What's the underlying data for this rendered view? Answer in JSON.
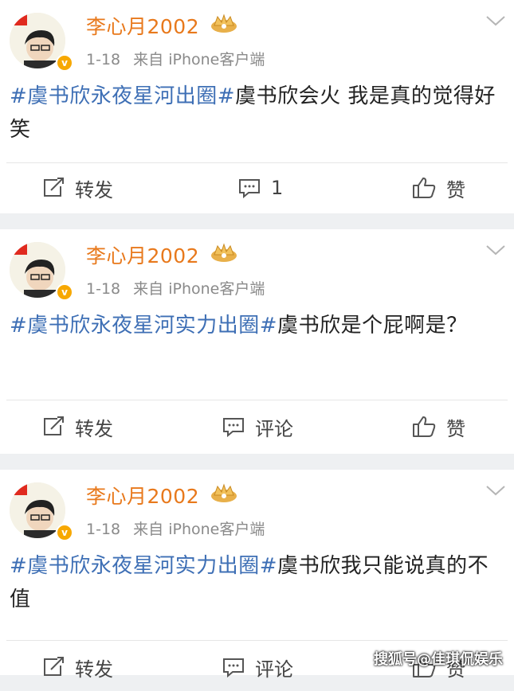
{
  "posts": [
    {
      "username": "李心月2002",
      "date": "1-18",
      "source": "来自 iPhone客户端",
      "hashtag": "#虞书欣永夜星河出圈#",
      "text": "虞书欣会火 我是真的觉得好笑",
      "actions": {
        "repost": "转发",
        "comment": "1",
        "like": "赞"
      }
    },
    {
      "username": "李心月2002",
      "date": "1-18",
      "source": "来自 iPhone客户端",
      "hashtag": "#虞书欣永夜星河实力出圈#",
      "text": "虞书欣是个屁啊是？",
      "actions": {
        "repost": "转发",
        "comment": "评论",
        "like": "赞"
      }
    },
    {
      "username": "李心月2002",
      "date": "1-18",
      "source": "来自 iPhone客户端",
      "hashtag": "#虞书欣永夜星河实力出圈#",
      "text": "虞书欣我只能说真的不值",
      "actions": {
        "repost": "转发",
        "comment": "评论",
        "like": "赞"
      }
    }
  ],
  "watermark": "搜狐号@佳琪侃娱乐",
  "colors": {
    "username": "#e8791c",
    "hashtag": "#3e6fb5",
    "verified": "#f7a800"
  }
}
